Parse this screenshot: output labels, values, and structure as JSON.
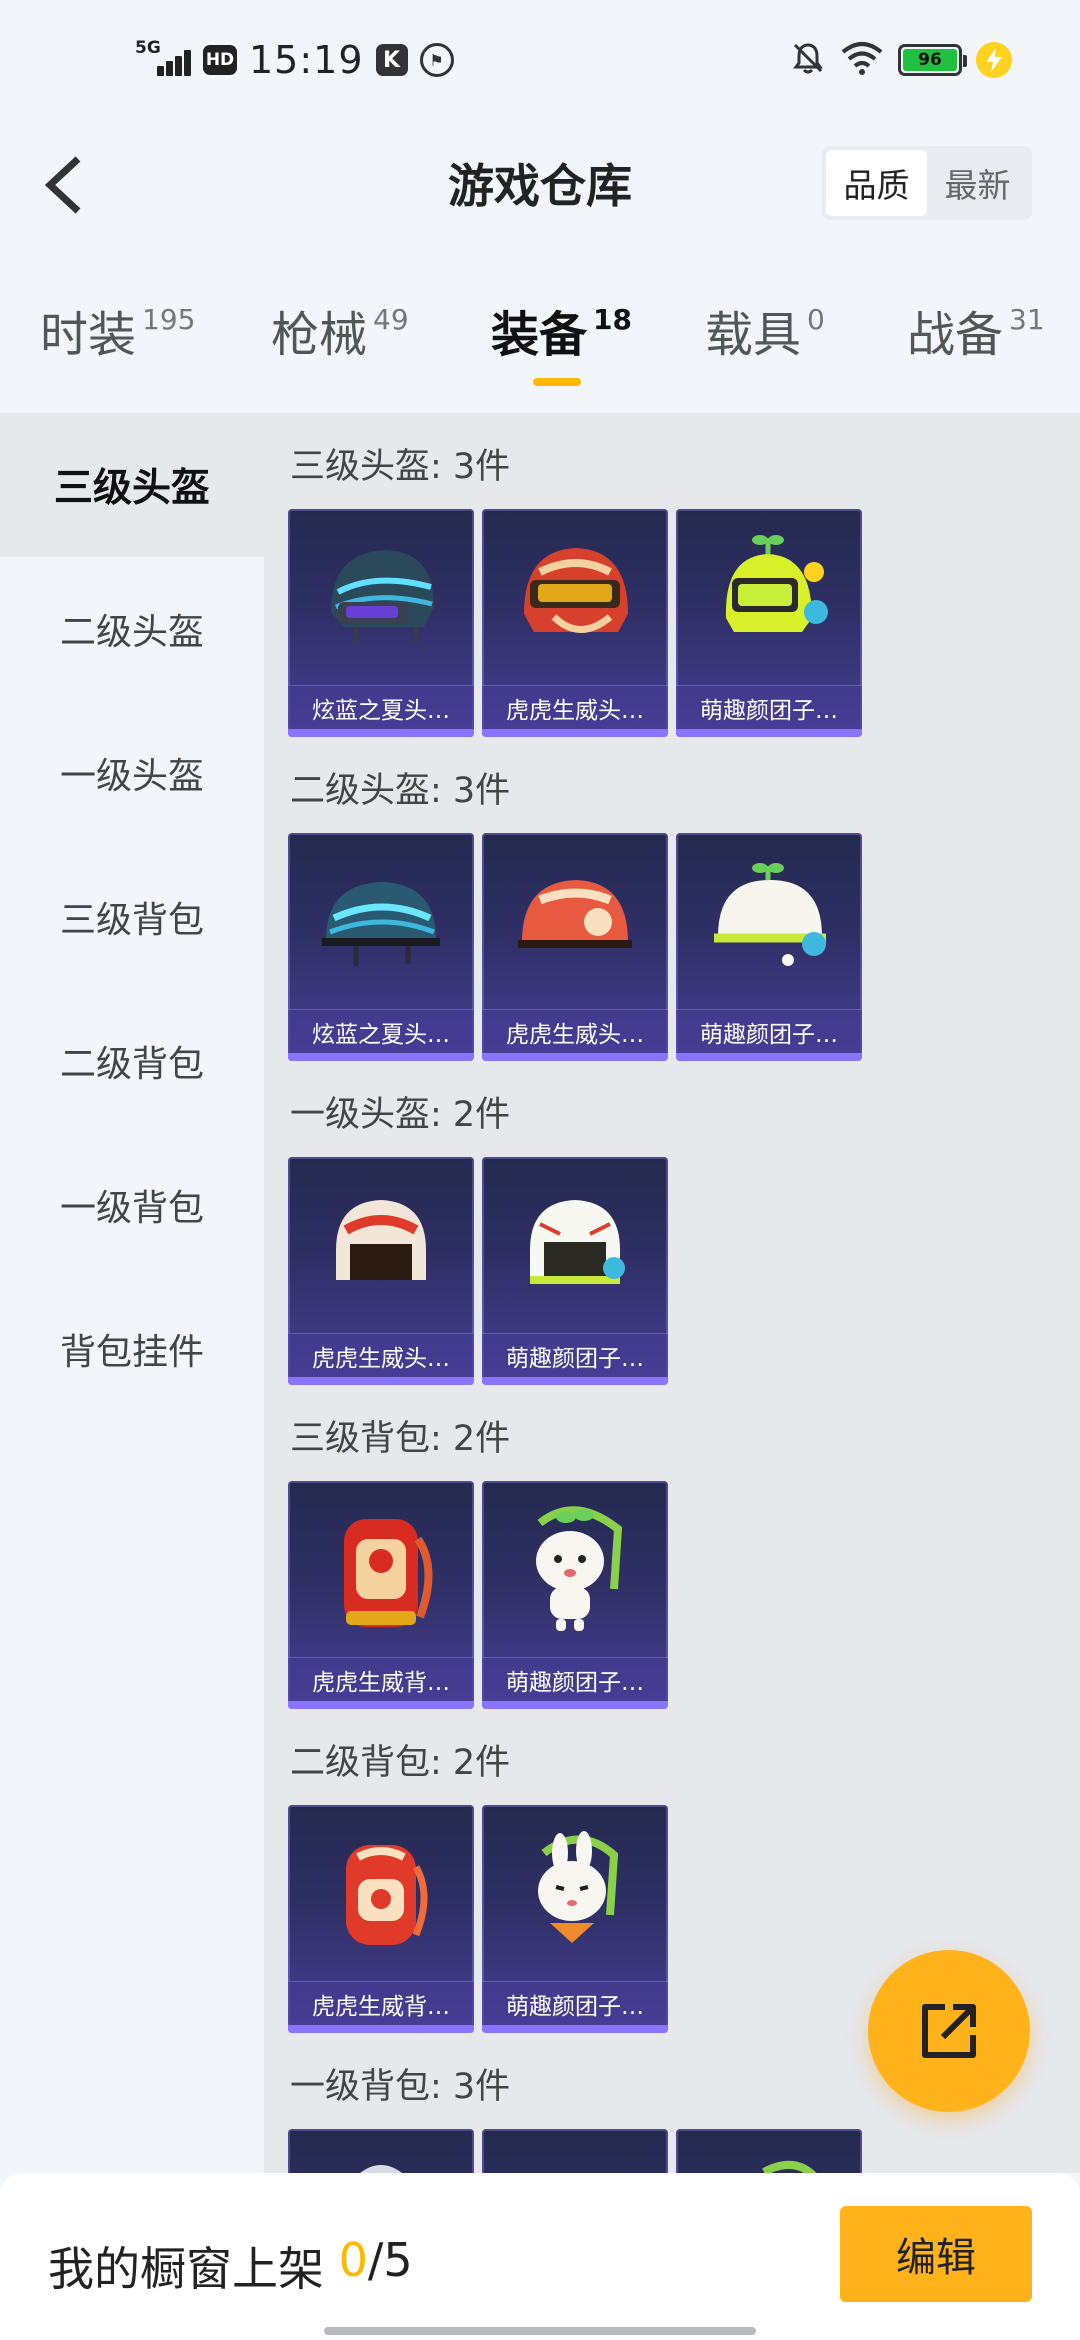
{
  "status_bar": {
    "network": "5G",
    "hd": "HD",
    "time": "15:19",
    "app_icon_1": "K",
    "app_icon_2": "⚑",
    "battery": "96"
  },
  "header": {
    "title": "游戏仓库",
    "sort_quality": "品质",
    "sort_newest": "最新"
  },
  "tabs": [
    {
      "label": "时装",
      "count": "195"
    },
    {
      "label": "枪械",
      "count": "49"
    },
    {
      "label": "装备",
      "count": "18"
    },
    {
      "label": "载具",
      "count": "0"
    },
    {
      "label": "战备",
      "count": "31"
    }
  ],
  "sidebar": [
    "三级头盔",
    "二级头盔",
    "一级头盔",
    "三级背包",
    "二级背包",
    "一级背包",
    "背包挂件"
  ],
  "sections": [
    {
      "title": "三级头盔: 3件",
      "items": [
        "炫蓝之夏头…",
        "虎虎生威头…",
        "萌趣颜团子…"
      ]
    },
    {
      "title": "二级头盔: 3件",
      "items": [
        "炫蓝之夏头…",
        "虎虎生威头…",
        "萌趣颜团子…"
      ]
    },
    {
      "title": "一级头盔: 2件",
      "items": [
        "虎虎生威头…",
        "萌趣颜团子…"
      ]
    },
    {
      "title": "三级背包: 2件",
      "items": [
        "虎虎生威背…",
        "萌趣颜团子…"
      ]
    },
    {
      "title": "二级背包: 2件",
      "items": [
        "虎虎生威背…",
        "萌趣颜团子…"
      ]
    },
    {
      "title": "一级背包: 3件",
      "items": [
        "",
        "",
        ""
      ]
    }
  ],
  "footer": {
    "shelf_label": "我的橱窗上架 ",
    "shelf_count": "0",
    "shelf_total": "/5",
    "edit_label": "编辑"
  }
}
